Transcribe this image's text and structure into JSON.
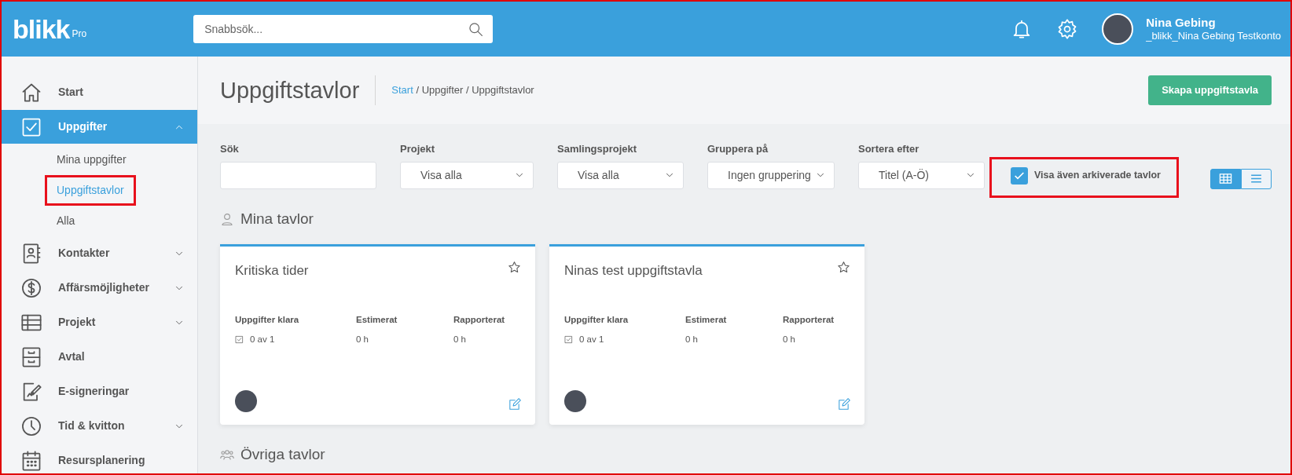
{
  "header": {
    "logo": "blikk",
    "logo_suffix": "Pro",
    "search": {
      "placeholder": "Snabbsök..."
    },
    "user": {
      "name": "Nina Gebing",
      "account": "_blikk_Nina Gebing Testkonto"
    }
  },
  "sidebar": {
    "items": [
      {
        "label": "Start",
        "selected": false,
        "expandable": false
      },
      {
        "label": "Uppgifter",
        "selected": true,
        "expandable": true,
        "expanded": true,
        "children": [
          {
            "label": "Mina uppgifter",
            "selected": false,
            "highlighted": false
          },
          {
            "label": "Uppgiftstavlor",
            "selected": true,
            "highlighted": true
          },
          {
            "label": "Alla",
            "selected": false,
            "highlighted": false
          }
        ]
      },
      {
        "label": "Kontakter",
        "selected": false,
        "expandable": true,
        "expanded": false
      },
      {
        "label": "Affärsmöjligheter",
        "selected": false,
        "expandable": true,
        "expanded": false
      },
      {
        "label": "Projekt",
        "selected": false,
        "expandable": true,
        "expanded": false
      },
      {
        "label": "Avtal",
        "selected": false,
        "expandable": false
      },
      {
        "label": "E-signeringar",
        "selected": false,
        "expandable": false
      },
      {
        "label": "Tid & kvitton",
        "selected": false,
        "expandable": true,
        "expanded": false
      },
      {
        "label": "Resursplanering",
        "selected": false,
        "expandable": false
      }
    ]
  },
  "page": {
    "title": "Uppgiftstavlor",
    "breadcrumb": [
      {
        "label": "Start",
        "link": true
      },
      {
        "label": "Uppgifter",
        "link": false
      },
      {
        "label": "Uppgiftstavlor",
        "link": false
      }
    ],
    "separator": "/",
    "create_button": "Skapa uppgiftstavla"
  },
  "filters": [
    {
      "kind": "text",
      "label": "Sök"
    },
    {
      "kind": "select",
      "label": "Projekt",
      "value": "Visa alla"
    },
    {
      "kind": "select",
      "label": "Samlingsprojekt",
      "value": "Visa alla"
    },
    {
      "kind": "select",
      "label": "Gruppera på",
      "value": "Ingen gruppering"
    },
    {
      "kind": "select",
      "label": "Sortera efter",
      "value": "Titel (A-Ö)"
    }
  ],
  "archived_checkbox": {
    "label": "Visa även arkiverade tavlor",
    "checked": true,
    "highlighted": true
  },
  "view_toggle": [
    {
      "kind": "grid",
      "selected": true
    },
    {
      "kind": "list",
      "selected": false
    }
  ],
  "sections": [
    {
      "title": "Mina tavlor",
      "boards": [
        {
          "title": "Kritiska tider",
          "starred": false,
          "stats": [
            {
              "kind": "tasks",
              "label": "Uppgifter klara",
              "value": "0 av 1"
            },
            {
              "kind": "plain",
              "label": "Estimerat",
              "value": "0 h"
            },
            {
              "kind": "plain",
              "label": "Rapporterat",
              "value": "0 h"
            }
          ]
        },
        {
          "title": "Ninas test uppgiftstavla",
          "starred": false,
          "stats": [
            {
              "kind": "tasks",
              "label": "Uppgifter klara",
              "value": "0 av 1"
            },
            {
              "kind": "plain",
              "label": "Estimerat",
              "value": "0 h"
            },
            {
              "kind": "plain",
              "label": "Rapporterat",
              "value": "0 h"
            }
          ]
        }
      ]
    },
    {
      "title": "Övriga tavlor"
    }
  ]
}
